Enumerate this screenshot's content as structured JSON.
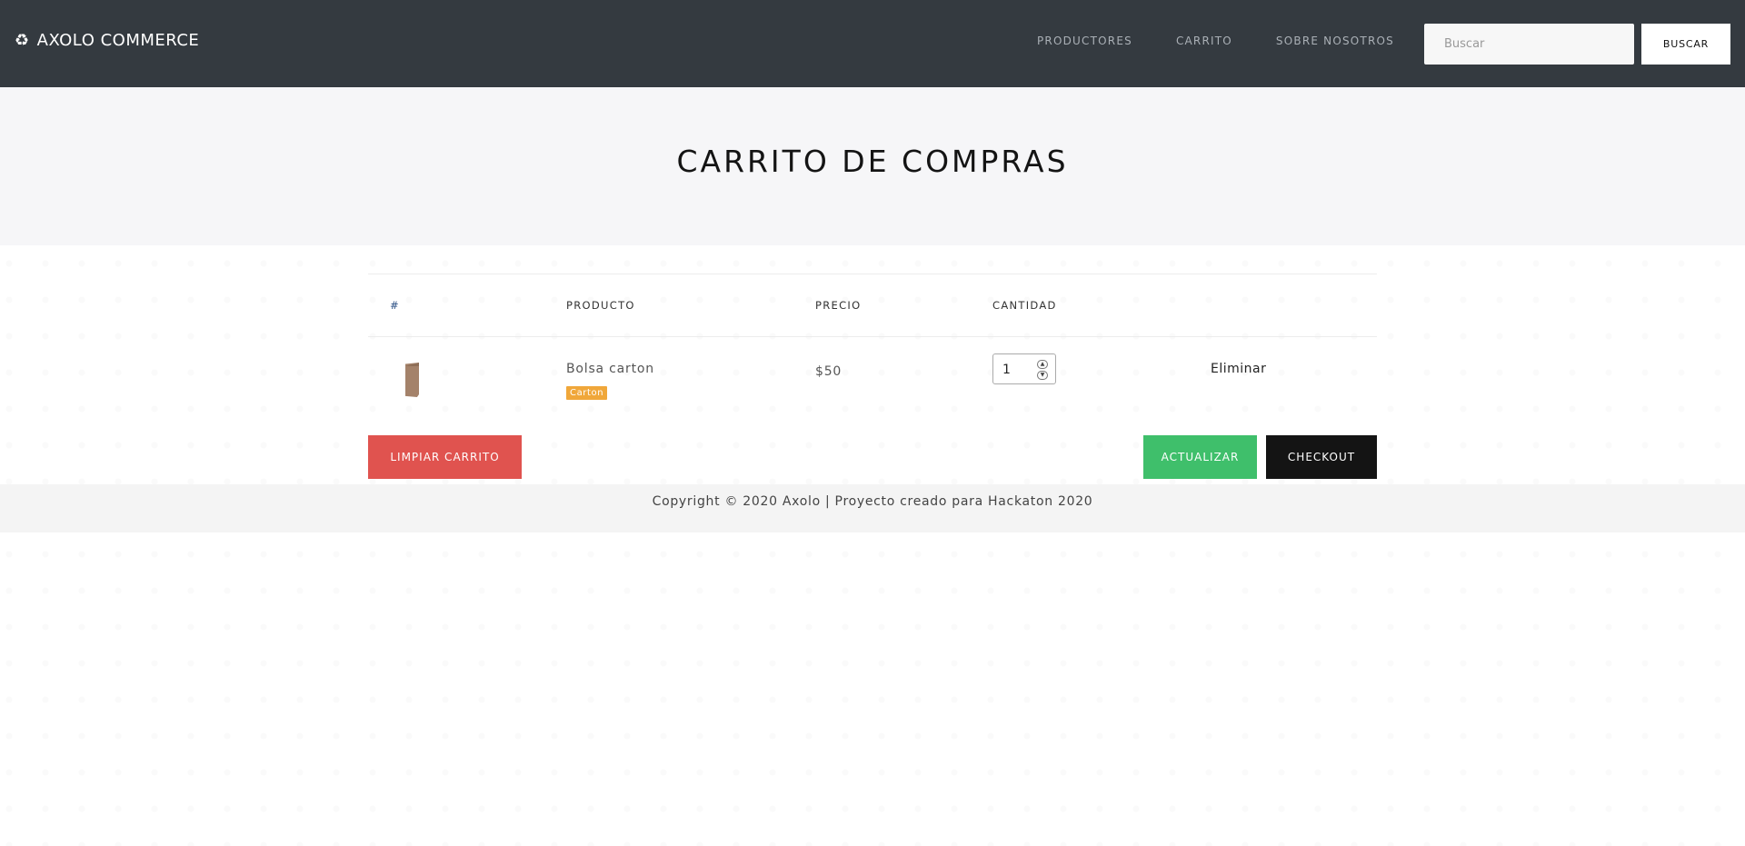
{
  "navbar": {
    "brand_icon": "♻",
    "brand_text": "AXOLO COMMERCE",
    "links": [
      {
        "label": "PRODUCTORES"
      },
      {
        "label": "CARRITO"
      },
      {
        "label": "SOBRE NOSOTROS"
      }
    ],
    "search": {
      "placeholder": "Buscar",
      "value": "",
      "button_label": "BUSCAR"
    }
  },
  "hero": {
    "title": "CARRITO DE COMPRAS"
  },
  "cart": {
    "columns": [
      "#",
      "PRODUCTO",
      "PRECIO",
      "CANTIDAD",
      ""
    ],
    "items": [
      {
        "image": "paper-bag-image",
        "name": "Bolsa carton",
        "badge": "Carton",
        "price": "$50",
        "quantity": "1",
        "remove_label": "Eliminar"
      }
    ],
    "actions": {
      "clear_label": "LIMPIAR CARRITO",
      "update_label": "ACTUALIZAR",
      "checkout_label": "CHECKOUT"
    }
  },
  "footer": {
    "text": "Copyright © 2020 Axolo | Proyecto creado para Hackaton 2020"
  },
  "colors": {
    "navbar_bg": "#343a40",
    "hero_bg": "#f6f6f8",
    "badge": "#f0a73a",
    "clear_button": "#e0534f",
    "update_button": "#3fbf6b",
    "checkout_button": "#141414",
    "footer_bg": "#f4f4f4"
  }
}
